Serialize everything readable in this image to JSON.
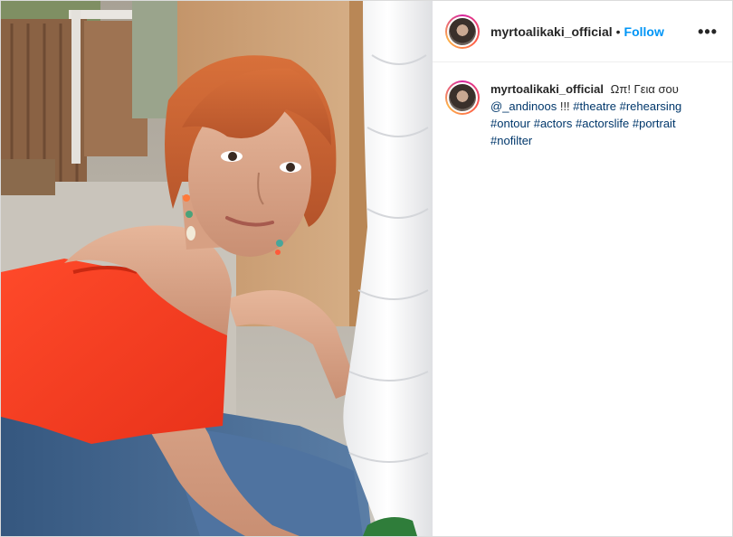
{
  "post": {
    "author": {
      "username": "myrtoalikaki_official",
      "separator": "•",
      "follow_label": "Follow",
      "more_label": "•••"
    },
    "caption": {
      "username": "myrtoalikaki_official",
      "text": "Ωπ! Γεια σου",
      "mention": "@_andinoos",
      "exclaim": "!!!",
      "hashtags": [
        "#theatre",
        "#rehearsing",
        "#ontour",
        "#actors",
        "#actorslife",
        "#portrait",
        "#nofilter"
      ]
    }
  },
  "colors": {
    "link": "#00376b",
    "follow": "#0095f6",
    "top_color": "#ff3b1f",
    "jeans_color": "#3b5f8a"
  }
}
